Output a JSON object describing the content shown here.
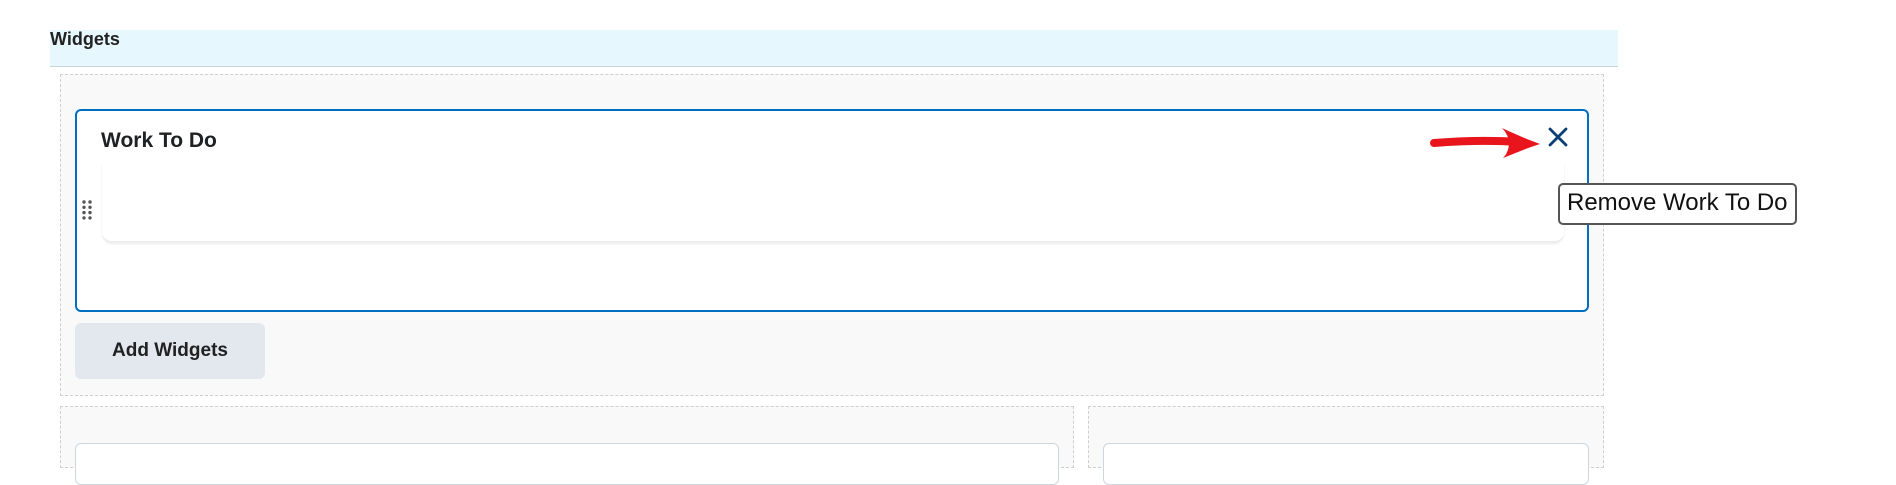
{
  "header": {
    "title": "Widgets",
    "background": "#e6f7fd"
  },
  "widget": {
    "title": "Work To Do",
    "close_icon": "close-icon",
    "drag_icon": "drag-handle-icon",
    "border_color": "#006fbf"
  },
  "tooltip": {
    "text": "Remove Work To Do"
  },
  "annotation": {
    "arrow_color": "#e8151c"
  },
  "actions": {
    "add_widgets_label": "Add Widgets"
  }
}
